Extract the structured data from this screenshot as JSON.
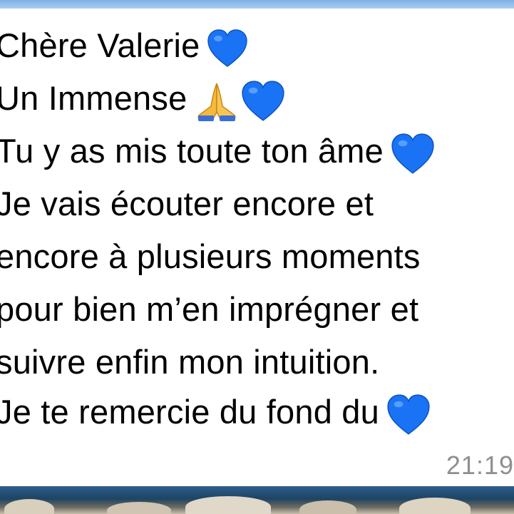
{
  "message": {
    "lines": [
      {
        "text": "Chère Valerie",
        "emoji": "blue-heart"
      },
      {
        "text": "Un Immense",
        "emoji": "folded-hands-blue-heart"
      },
      {
        "text": "Tu y as mis toute ton âme",
        "emoji": "blue-heart"
      },
      {
        "text": "Je vais écouter encore et",
        "emoji": null
      },
      {
        "text": "encore à plusieurs moments",
        "emoji": null
      },
      {
        "text": "pour bien m’en imprégner et",
        "emoji": null
      },
      {
        "text": "suivre enfin mon intuition.",
        "emoji": null
      },
      {
        "text": "Je te remercie du fond du",
        "emoji": "blue-heart"
      }
    ],
    "timestamp": "21:19"
  },
  "colors": {
    "heart": "#1a73f5",
    "hands": "#f6b93b",
    "text": "#000000",
    "timestamp": "#8e8e93"
  }
}
